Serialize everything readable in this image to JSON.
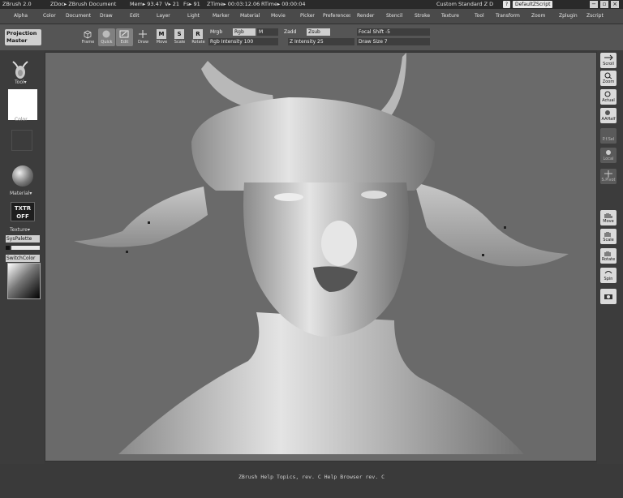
{
  "titlebar": {
    "app": "ZBrush 2.0",
    "doc": "ZDoc▸ ZBrush Document",
    "mem": "Mem▸ 93.47",
    "verts": "V▸ 21",
    "fs": "Fs▸ 91",
    "ztime": "ZTime▸ 00:03:12.06",
    "rtime": "RTime▸ 00:00:04",
    "layout": "Custom  Standard  Z  D",
    "help_glyph": "?",
    "script_button": "DefaultZScript",
    "win_controls": [
      "−",
      "▫",
      "×"
    ]
  },
  "menu": [
    "Alpha",
    "Color",
    "Document",
    "Draw",
    "Edit",
    "Layer",
    "Light",
    "Marker",
    "Material",
    "Movie",
    "Picker",
    "Preferences",
    "Render",
    "Stencil",
    "Stroke",
    "Texture",
    "Tool",
    "Transform",
    "Zoom",
    "Zplugin",
    "Zscript"
  ],
  "toolbar": {
    "projection_master": [
      "Projection",
      "Master"
    ],
    "frame": "Frame",
    "quick": "Quick",
    "edit": "Edit",
    "draw": "Draw",
    "move": "Move",
    "scale": "Scale",
    "rotate": "Rotate",
    "move_key": "M",
    "scale_key": "S",
    "rotate_key": "R",
    "mrgb": "Mrgb",
    "rgb": "Rgb",
    "m": "M",
    "zadd": "Zadd",
    "zsub": "Zsub",
    "rgb_intensity": "Rgb  Intensity 100",
    "z_intensity": "Z  Intensity 25",
    "focal_shift": "Focal Shift  -5",
    "draw_size": "Draw  Size 7"
  },
  "left_tray": {
    "tool": "Tool▾",
    "color": "Color",
    "material": "Material▾",
    "txtr": [
      "TXTR",
      "OFF"
    ],
    "texture": "Texture▾",
    "syspalette": "SysPalette",
    "switchcolor": "SwitchColor"
  },
  "right_tray": {
    "scroll": "Scroll",
    "zoom": "Zoom",
    "actual": "Actual",
    "aahalf": "AAHalf",
    "pfsel": "P.f.Sel",
    "local": "Local",
    "spivot": "S.Pivot",
    "move": "Move",
    "scale": "Scale",
    "rotate": "Rotate",
    "spin": "Spin"
  },
  "status": {
    "help": "ZBrush Help Topics, rev. C    Help Browser rev. C"
  },
  "colors": {
    "canvas_bg": "#6a6a6a",
    "ui_dark": "#3a3a3a",
    "highlight_button": "#cfcfcf"
  }
}
